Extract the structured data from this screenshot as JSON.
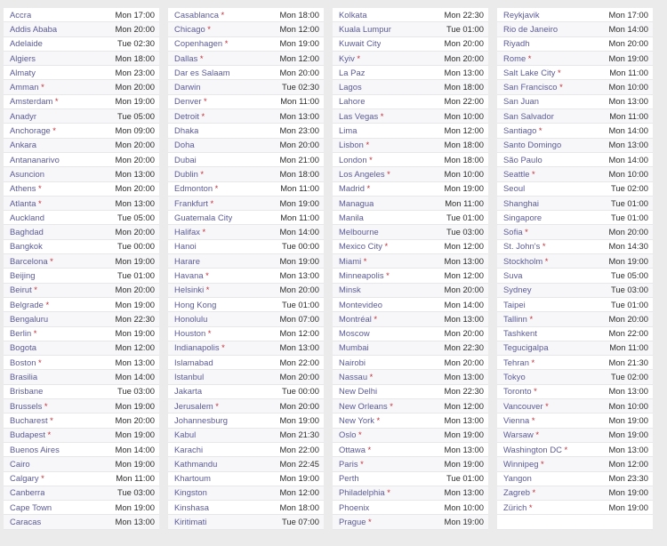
{
  "meta": {
    "view": "world-clock-city-time-list",
    "dst_marker": "*",
    "accent_city_color": "#5a5a96",
    "dst_marker_color": "#c0303a",
    "time_color": "#2b2b2b",
    "row_alt_color": "#f7f7f9",
    "page_background": "#ebebeb"
  },
  "columns": [
    {
      "index": 1,
      "rows": [
        {
          "city": "Accra",
          "dst": false,
          "time": "Mon 17:00"
        },
        {
          "city": "Addis Ababa",
          "dst": false,
          "time": "Mon 20:00"
        },
        {
          "city": "Adelaide",
          "dst": false,
          "time": "Tue 02:30"
        },
        {
          "city": "Algiers",
          "dst": false,
          "time": "Mon 18:00"
        },
        {
          "city": "Almaty",
          "dst": false,
          "time": "Mon 23:00"
        },
        {
          "city": "Amman",
          "dst": true,
          "time": "Mon 20:00"
        },
        {
          "city": "Amsterdam",
          "dst": true,
          "time": "Mon 19:00"
        },
        {
          "city": "Anadyr",
          "dst": false,
          "time": "Tue 05:00"
        },
        {
          "city": "Anchorage",
          "dst": true,
          "time": "Mon 09:00"
        },
        {
          "city": "Ankara",
          "dst": false,
          "time": "Mon 20:00"
        },
        {
          "city": "Antananarivo",
          "dst": false,
          "time": "Mon 20:00"
        },
        {
          "city": "Asuncion",
          "dst": false,
          "time": "Mon 13:00"
        },
        {
          "city": "Athens",
          "dst": true,
          "time": "Mon 20:00"
        },
        {
          "city": "Atlanta",
          "dst": true,
          "time": "Mon 13:00"
        },
        {
          "city": "Auckland",
          "dst": false,
          "time": "Tue 05:00"
        },
        {
          "city": "Baghdad",
          "dst": false,
          "time": "Mon 20:00"
        },
        {
          "city": "Bangkok",
          "dst": false,
          "time": "Tue 00:00"
        },
        {
          "city": "Barcelona",
          "dst": true,
          "time": "Mon 19:00"
        },
        {
          "city": "Beijing",
          "dst": false,
          "time": "Tue 01:00"
        },
        {
          "city": "Beirut",
          "dst": true,
          "time": "Mon 20:00"
        },
        {
          "city": "Belgrade",
          "dst": true,
          "time": "Mon 19:00"
        },
        {
          "city": "Bengaluru",
          "dst": false,
          "time": "Mon 22:30"
        },
        {
          "city": "Berlin",
          "dst": true,
          "time": "Mon 19:00"
        },
        {
          "city": "Bogota",
          "dst": false,
          "time": "Mon 12:00"
        },
        {
          "city": "Boston",
          "dst": true,
          "time": "Mon 13:00"
        },
        {
          "city": "Brasilia",
          "dst": false,
          "time": "Mon 14:00"
        },
        {
          "city": "Brisbane",
          "dst": false,
          "time": "Tue 03:00"
        },
        {
          "city": "Brussels",
          "dst": true,
          "time": "Mon 19:00"
        },
        {
          "city": "Bucharest",
          "dst": true,
          "time": "Mon 20:00"
        },
        {
          "city": "Budapest",
          "dst": true,
          "time": "Mon 19:00"
        },
        {
          "city": "Buenos Aires",
          "dst": false,
          "time": "Mon 14:00"
        },
        {
          "city": "Cairo",
          "dst": false,
          "time": "Mon 19:00"
        },
        {
          "city": "Calgary",
          "dst": true,
          "time": "Mon 11:00"
        },
        {
          "city": "Canberra",
          "dst": false,
          "time": "Tue 03:00"
        },
        {
          "city": "Cape Town",
          "dst": false,
          "time": "Mon 19:00"
        },
        {
          "city": "Caracas",
          "dst": false,
          "time": "Mon 13:00"
        }
      ]
    },
    {
      "index": 2,
      "rows": [
        {
          "city": "Casablanca",
          "dst": true,
          "time": "Mon 18:00"
        },
        {
          "city": "Chicago",
          "dst": true,
          "time": "Mon 12:00"
        },
        {
          "city": "Copenhagen",
          "dst": true,
          "time": "Mon 19:00"
        },
        {
          "city": "Dallas",
          "dst": true,
          "time": "Mon 12:00"
        },
        {
          "city": "Dar es Salaam",
          "dst": false,
          "time": "Mon 20:00"
        },
        {
          "city": "Darwin",
          "dst": false,
          "time": "Tue 02:30"
        },
        {
          "city": "Denver",
          "dst": true,
          "time": "Mon 11:00"
        },
        {
          "city": "Detroit",
          "dst": true,
          "time": "Mon 13:00"
        },
        {
          "city": "Dhaka",
          "dst": false,
          "time": "Mon 23:00"
        },
        {
          "city": "Doha",
          "dst": false,
          "time": "Mon 20:00"
        },
        {
          "city": "Dubai",
          "dst": false,
          "time": "Mon 21:00"
        },
        {
          "city": "Dublin",
          "dst": true,
          "time": "Mon 18:00"
        },
        {
          "city": "Edmonton",
          "dst": true,
          "time": "Mon 11:00"
        },
        {
          "city": "Frankfurt",
          "dst": true,
          "time": "Mon 19:00"
        },
        {
          "city": "Guatemala City",
          "dst": false,
          "time": "Mon 11:00"
        },
        {
          "city": "Halifax",
          "dst": true,
          "time": "Mon 14:00"
        },
        {
          "city": "Hanoi",
          "dst": false,
          "time": "Tue 00:00"
        },
        {
          "city": "Harare",
          "dst": false,
          "time": "Mon 19:00"
        },
        {
          "city": "Havana",
          "dst": true,
          "time": "Mon 13:00"
        },
        {
          "city": "Helsinki",
          "dst": true,
          "time": "Mon 20:00"
        },
        {
          "city": "Hong Kong",
          "dst": false,
          "time": "Tue 01:00"
        },
        {
          "city": "Honolulu",
          "dst": false,
          "time": "Mon 07:00"
        },
        {
          "city": "Houston",
          "dst": true,
          "time": "Mon 12:00"
        },
        {
          "city": "Indianapolis",
          "dst": true,
          "time": "Mon 13:00"
        },
        {
          "city": "Islamabad",
          "dst": false,
          "time": "Mon 22:00"
        },
        {
          "city": "Istanbul",
          "dst": false,
          "time": "Mon 20:00"
        },
        {
          "city": "Jakarta",
          "dst": false,
          "time": "Tue 00:00"
        },
        {
          "city": "Jerusalem",
          "dst": true,
          "time": "Mon 20:00"
        },
        {
          "city": "Johannesburg",
          "dst": false,
          "time": "Mon 19:00"
        },
        {
          "city": "Kabul",
          "dst": false,
          "time": "Mon 21:30"
        },
        {
          "city": "Karachi",
          "dst": false,
          "time": "Mon 22:00"
        },
        {
          "city": "Kathmandu",
          "dst": false,
          "time": "Mon 22:45"
        },
        {
          "city": "Khartoum",
          "dst": false,
          "time": "Mon 19:00"
        },
        {
          "city": "Kingston",
          "dst": false,
          "time": "Mon 12:00"
        },
        {
          "city": "Kinshasa",
          "dst": false,
          "time": "Mon 18:00"
        },
        {
          "city": "Kiritimati",
          "dst": false,
          "time": "Tue 07:00"
        }
      ]
    },
    {
      "index": 3,
      "rows": [
        {
          "city": "Kolkata",
          "dst": false,
          "time": "Mon 22:30"
        },
        {
          "city": "Kuala Lumpur",
          "dst": false,
          "time": "Tue 01:00"
        },
        {
          "city": "Kuwait City",
          "dst": false,
          "time": "Mon 20:00"
        },
        {
          "city": "Kyiv",
          "dst": true,
          "time": "Mon 20:00"
        },
        {
          "city": "La Paz",
          "dst": false,
          "time": "Mon 13:00"
        },
        {
          "city": "Lagos",
          "dst": false,
          "time": "Mon 18:00"
        },
        {
          "city": "Lahore",
          "dst": false,
          "time": "Mon 22:00"
        },
        {
          "city": "Las Vegas",
          "dst": true,
          "time": "Mon 10:00"
        },
        {
          "city": "Lima",
          "dst": false,
          "time": "Mon 12:00"
        },
        {
          "city": "Lisbon",
          "dst": true,
          "time": "Mon 18:00"
        },
        {
          "city": "London",
          "dst": true,
          "time": "Mon 18:00"
        },
        {
          "city": "Los Angeles",
          "dst": true,
          "time": "Mon 10:00"
        },
        {
          "city": "Madrid",
          "dst": true,
          "time": "Mon 19:00"
        },
        {
          "city": "Managua",
          "dst": false,
          "time": "Mon 11:00"
        },
        {
          "city": "Manila",
          "dst": false,
          "time": "Tue 01:00"
        },
        {
          "city": "Melbourne",
          "dst": false,
          "time": "Tue 03:00"
        },
        {
          "city": "Mexico City",
          "dst": true,
          "time": "Mon 12:00"
        },
        {
          "city": "Miami",
          "dst": true,
          "time": "Mon 13:00"
        },
        {
          "city": "Minneapolis",
          "dst": true,
          "time": "Mon 12:00"
        },
        {
          "city": "Minsk",
          "dst": false,
          "time": "Mon 20:00"
        },
        {
          "city": "Montevideo",
          "dst": false,
          "time": "Mon 14:00"
        },
        {
          "city": "Montréal",
          "dst": true,
          "time": "Mon 13:00"
        },
        {
          "city": "Moscow",
          "dst": false,
          "time": "Mon 20:00"
        },
        {
          "city": "Mumbai",
          "dst": false,
          "time": "Mon 22:30"
        },
        {
          "city": "Nairobi",
          "dst": false,
          "time": "Mon 20:00"
        },
        {
          "city": "Nassau",
          "dst": true,
          "time": "Mon 13:00"
        },
        {
          "city": "New Delhi",
          "dst": false,
          "time": "Mon 22:30"
        },
        {
          "city": "New Orleans",
          "dst": true,
          "time": "Mon 12:00"
        },
        {
          "city": "New York",
          "dst": true,
          "time": "Mon 13:00"
        },
        {
          "city": "Oslo",
          "dst": true,
          "time": "Mon 19:00"
        },
        {
          "city": "Ottawa",
          "dst": true,
          "time": "Mon 13:00"
        },
        {
          "city": "Paris",
          "dst": true,
          "time": "Mon 19:00"
        },
        {
          "city": "Perth",
          "dst": false,
          "time": "Tue 01:00"
        },
        {
          "city": "Philadelphia",
          "dst": true,
          "time": "Mon 13:00"
        },
        {
          "city": "Phoenix",
          "dst": false,
          "time": "Mon 10:00"
        },
        {
          "city": "Prague",
          "dst": true,
          "time": "Mon 19:00"
        }
      ]
    },
    {
      "index": 4,
      "rows": [
        {
          "city": "Reykjavik",
          "dst": false,
          "time": "Mon 17:00"
        },
        {
          "city": "Rio de Janeiro",
          "dst": false,
          "time": "Mon 14:00"
        },
        {
          "city": "Riyadh",
          "dst": false,
          "time": "Mon 20:00"
        },
        {
          "city": "Rome",
          "dst": true,
          "time": "Mon 19:00"
        },
        {
          "city": "Salt Lake City",
          "dst": true,
          "time": "Mon 11:00"
        },
        {
          "city": "San Francisco",
          "dst": true,
          "time": "Mon 10:00"
        },
        {
          "city": "San Juan",
          "dst": false,
          "time": "Mon 13:00"
        },
        {
          "city": "San Salvador",
          "dst": false,
          "time": "Mon 11:00"
        },
        {
          "city": "Santiago",
          "dst": true,
          "time": "Mon 14:00"
        },
        {
          "city": "Santo Domingo",
          "dst": false,
          "time": "Mon 13:00"
        },
        {
          "city": "São Paulo",
          "dst": false,
          "time": "Mon 14:00"
        },
        {
          "city": "Seattle",
          "dst": true,
          "time": "Mon 10:00"
        },
        {
          "city": "Seoul",
          "dst": false,
          "time": "Tue 02:00"
        },
        {
          "city": "Shanghai",
          "dst": false,
          "time": "Tue 01:00"
        },
        {
          "city": "Singapore",
          "dst": false,
          "time": "Tue 01:00"
        },
        {
          "city": "Sofia",
          "dst": true,
          "time": "Mon 20:00"
        },
        {
          "city": "St. John's",
          "dst": true,
          "time": "Mon 14:30"
        },
        {
          "city": "Stockholm",
          "dst": true,
          "time": "Mon 19:00"
        },
        {
          "city": "Suva",
          "dst": false,
          "time": "Tue 05:00"
        },
        {
          "city": "Sydney",
          "dst": false,
          "time": "Tue 03:00"
        },
        {
          "city": "Taipei",
          "dst": false,
          "time": "Tue 01:00"
        },
        {
          "city": "Tallinn",
          "dst": true,
          "time": "Mon 20:00"
        },
        {
          "city": "Tashkent",
          "dst": false,
          "time": "Mon 22:00"
        },
        {
          "city": "Tegucigalpa",
          "dst": false,
          "time": "Mon 11:00"
        },
        {
          "city": "Tehran",
          "dst": true,
          "time": "Mon 21:30"
        },
        {
          "city": "Tokyo",
          "dst": false,
          "time": "Tue 02:00"
        },
        {
          "city": "Toronto",
          "dst": true,
          "time": "Mon 13:00"
        },
        {
          "city": "Vancouver",
          "dst": true,
          "time": "Mon 10:00"
        },
        {
          "city": "Vienna",
          "dst": true,
          "time": "Mon 19:00"
        },
        {
          "city": "Warsaw",
          "dst": true,
          "time": "Mon 19:00"
        },
        {
          "city": "Washington DC",
          "dst": true,
          "time": "Mon 13:00"
        },
        {
          "city": "Winnipeg",
          "dst": true,
          "time": "Mon 12:00"
        },
        {
          "city": "Yangon",
          "dst": false,
          "time": "Mon 23:30"
        },
        {
          "city": "Zagreb",
          "dst": true,
          "time": "Mon 19:00"
        },
        {
          "city": "Zürich",
          "dst": true,
          "time": "Mon 19:00"
        }
      ]
    }
  ]
}
